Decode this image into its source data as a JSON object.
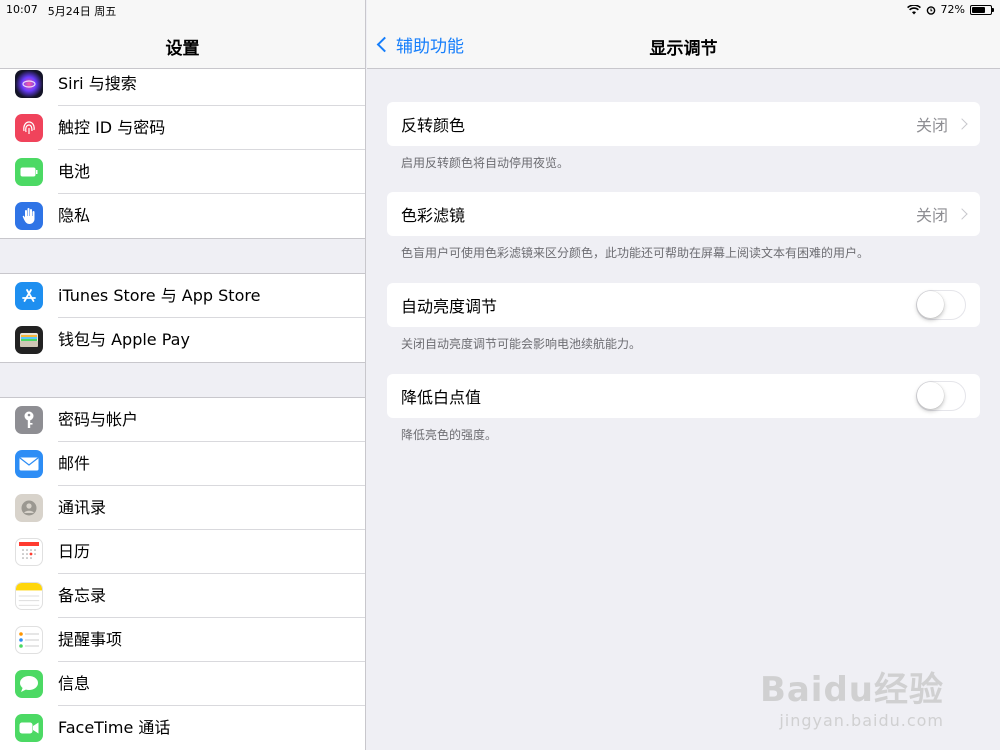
{
  "status_bar": {
    "time": "10:07",
    "date": "5月24日 周五",
    "battery": "72%",
    "battery_level": 0.72
  },
  "left": {
    "title": "设置",
    "groups": [
      {
        "items": [
          {
            "label": "Siri 与搜索",
            "icon": "siri-icon",
            "color": "#1a1a2e"
          },
          {
            "label": "触控 ID 与密码",
            "icon": "fingerprint-icon",
            "color": "#f0435b"
          },
          {
            "label": "电池",
            "icon": "battery-icon",
            "color": "#4cd964"
          },
          {
            "label": "隐私",
            "icon": "hand-icon",
            "color": "#2f74e6"
          }
        ]
      },
      {
        "items": [
          {
            "label": "iTunes Store 与 App Store",
            "icon": "app-store-icon",
            "color": "#1e8ff0"
          },
          {
            "label": "钱包与 Apple Pay",
            "icon": "wallet-icon",
            "color": "#222222"
          }
        ]
      },
      {
        "items": [
          {
            "label": "密码与帐户",
            "icon": "key-icon",
            "color": "#8e8e93"
          },
          {
            "label": "邮件",
            "icon": "mail-icon",
            "color": "#2d8df5"
          },
          {
            "label": "通讯录",
            "icon": "contacts-icon",
            "color": "#d8d3cb"
          },
          {
            "label": "日历",
            "icon": "calendar-icon",
            "color": "#ffffff"
          },
          {
            "label": "备忘录",
            "icon": "notes-icon",
            "color": "#ffffff"
          },
          {
            "label": "提醒事项",
            "icon": "reminders-icon",
            "color": "#ffffff"
          },
          {
            "label": "信息",
            "icon": "messages-icon",
            "color": "#4cd964"
          },
          {
            "label": "FaceTime 通话",
            "icon": "facetime-icon",
            "color": "#4cd964"
          }
        ]
      }
    ]
  },
  "right": {
    "back_label": "辅助功能",
    "title": "显示调节",
    "rows": [
      {
        "label": "反转颜色",
        "value": "关闭",
        "note": "启用反转颜色将自动停用夜览。"
      },
      {
        "label": "色彩滤镜",
        "value": "关闭",
        "note": "色盲用户可使用色彩滤镜来区分颜色，此功能还可帮助在屏幕上阅读文本有困难的用户。"
      },
      {
        "label": "自动亮度调节",
        "toggle": false,
        "note": "关闭自动亮度调节可能会影响电池续航能力。"
      },
      {
        "label": "降低白点值",
        "toggle": false,
        "note": "降低亮色的强度。"
      }
    ]
  },
  "watermark": {
    "brand": "Baidu经验",
    "url": "jingyan.baidu.com"
  }
}
